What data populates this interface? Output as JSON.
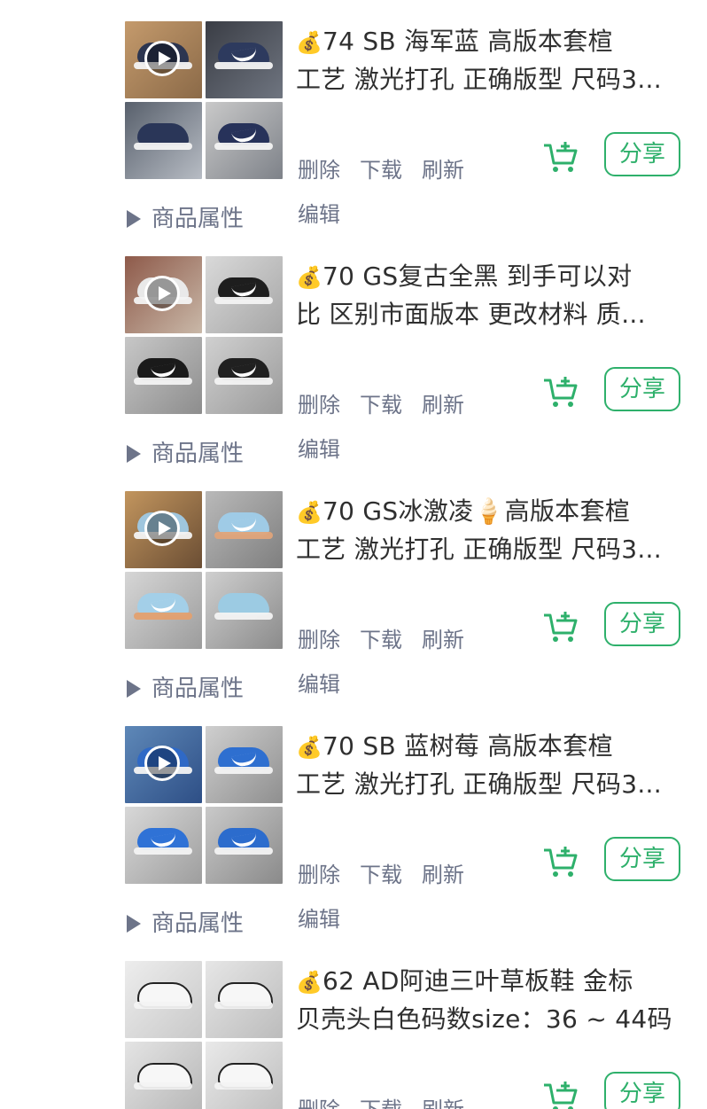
{
  "colors": {
    "accent": "#2eb06b",
    "muted": "#6d7489",
    "text": "#2f2f2f"
  },
  "common": {
    "delete": "删除",
    "download": "下载",
    "refresh": "刷新",
    "edit": "编辑",
    "attrs": "商品属性",
    "share": "分享",
    "cart_icon": "add-to-cart-icon",
    "money_icon": "💰"
  },
  "products": [
    {
      "line1": "74 SB 海军蓝 高版本套楦",
      "line2": "工艺 激光打孔 正确版型 尺码3...",
      "has_video": true
    },
    {
      "line1": "70 GS复古全黑 到手可以对",
      "line2": "比 区别市面版本 更改材料 质...",
      "has_video": true
    },
    {
      "line1": "70 GS冰激凌🍦高版本套楦",
      "line2": "工艺 激光打孔 正确版型 尺码3...",
      "has_video": true
    },
    {
      "line1": "70 SB 蓝树莓 高版本套楦",
      "line2": "工艺 激光打孔 正确版型 尺码3...",
      "has_video": true
    },
    {
      "line1": "62 AD阿迪三叶草板鞋 金标",
      "line2": "贝壳头白色码数size：36 ~ 44码",
      "has_video": false
    }
  ]
}
